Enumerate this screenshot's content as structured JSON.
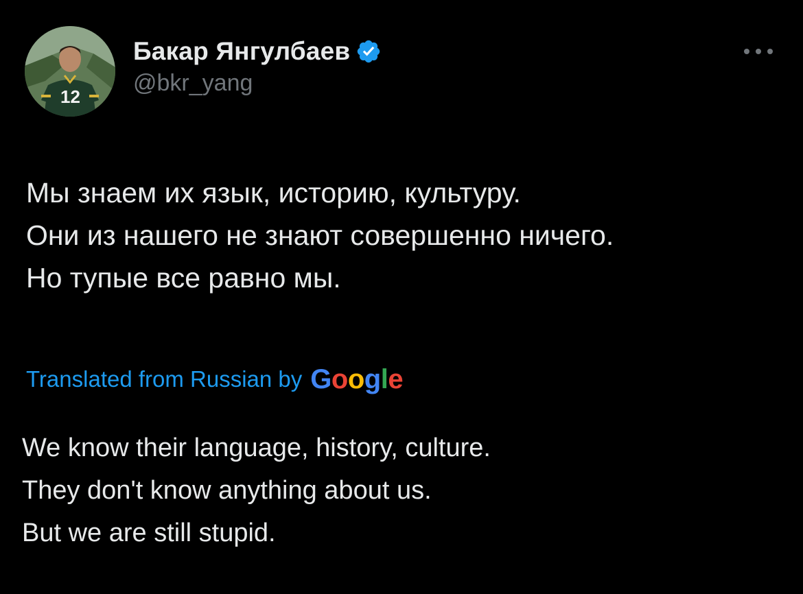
{
  "author": {
    "display_name": "Бакар Янгулбаев",
    "handle": "@bkr_yang",
    "verified": true,
    "avatar_jersey_number": "12"
  },
  "tweet": {
    "lines": [
      "Мы знаем их язык, историю, культуру.",
      "Они из нашего не знают совершенно ничего.",
      "Но тупые все равно мы."
    ]
  },
  "translation": {
    "label": "Translated from Russian by",
    "provider_letters": [
      "G",
      "o",
      "o",
      "g",
      "l",
      "e"
    ],
    "lines": [
      "We know their language, history, culture.",
      "They don't know anything about us.",
      "But we are still stupid."
    ]
  },
  "icons": {
    "verified": "verified-badge-icon",
    "more": "more-horizontal-icon"
  },
  "colors": {
    "background": "#000000",
    "text_primary": "#e7e9ea",
    "text_secondary": "#71767b",
    "accent": "#1d9bf0",
    "google_blue": "#4285f4",
    "google_red": "#ea4335",
    "google_yellow": "#fbbc05",
    "google_green": "#34a853"
  }
}
